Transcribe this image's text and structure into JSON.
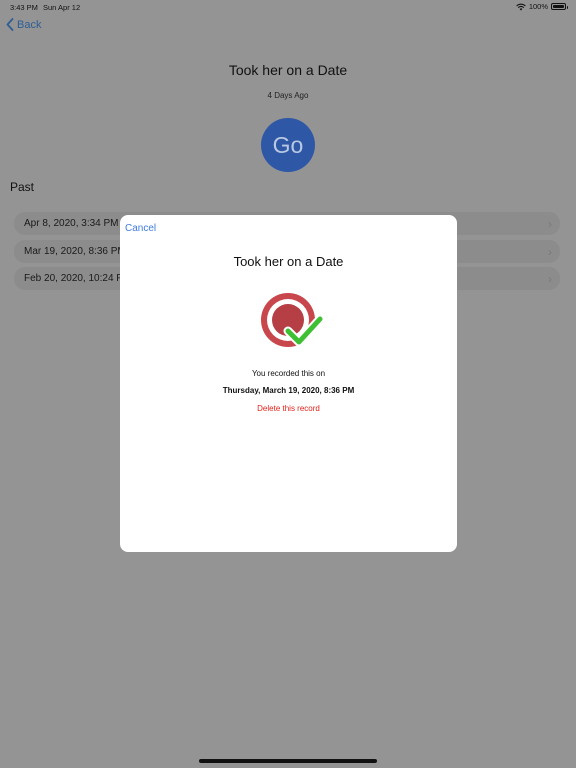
{
  "status_bar": {
    "time": "3:43 PM",
    "date": "Sun Apr 12",
    "battery": "100%"
  },
  "nav": {
    "back_label": "Back"
  },
  "background": {
    "title": "Took her on a Date",
    "subtitle": "4 Days Ago",
    "go_label": "Go",
    "past_header": "Past",
    "past_items": [
      {
        "label": "Apr 8, 2020, 3:34 PM"
      },
      {
        "label": "Mar 19, 2020, 8:36 PM"
      },
      {
        "label": "Feb 20, 2020, 10:24 PM"
      }
    ]
  },
  "modal": {
    "cancel_label": "Cancel",
    "title": "Took her on a Date",
    "recorded_text": "You recorded this on",
    "recorded_date": "Thursday, March 19, 2020, 8:36 PM",
    "delete_label": "Delete this record"
  },
  "colors": {
    "accent": "#3f7ce0",
    "danger": "#e0201a",
    "go_button": "#2e58a6",
    "record_icon": "#c8474c",
    "check": "#3fbf34"
  }
}
